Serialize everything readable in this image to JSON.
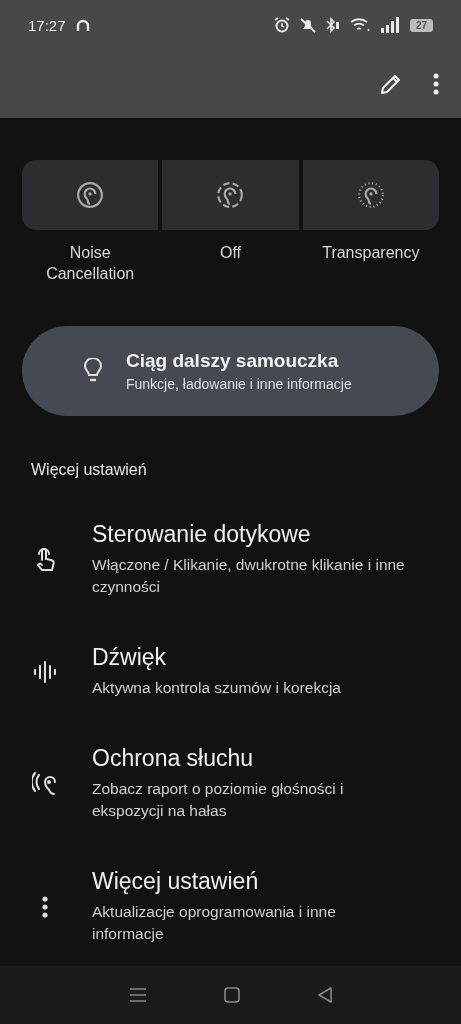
{
  "status_bar": {
    "time": "17:27",
    "battery": "27"
  },
  "anc": {
    "modes": [
      {
        "kind": "cancel",
        "label": "Noise Cancellation",
        "selected": false
      },
      {
        "kind": "off",
        "label": "Off",
        "selected": false
      },
      {
        "kind": "transparency",
        "label": "Transparency",
        "selected": false
      }
    ]
  },
  "tutorial": {
    "title": "Ciąg dalszy samouczka",
    "subtitle": "Funkcje, ładowanie i inne informacje"
  },
  "more_settings": {
    "title": "Więcej ustawień",
    "items": [
      {
        "kind": "touch",
        "title": "Sterowanie dotykowe",
        "subtitle": "Włączone / Klikanie, dwukrotne klikanie i inne czynności"
      },
      {
        "kind": "sound",
        "title": "Dźwięk",
        "subtitle": "Aktywna kontrola szumów i korekcja"
      },
      {
        "kind": "hearing",
        "title": "Ochrona słuchu",
        "subtitle": "Zobacz raport o poziomie głośności i ekspozycji na hałas"
      },
      {
        "kind": "more",
        "title": "Więcej ustawień",
        "subtitle": "Aktualizacje oprogramowania i inne informacje"
      }
    ]
  }
}
